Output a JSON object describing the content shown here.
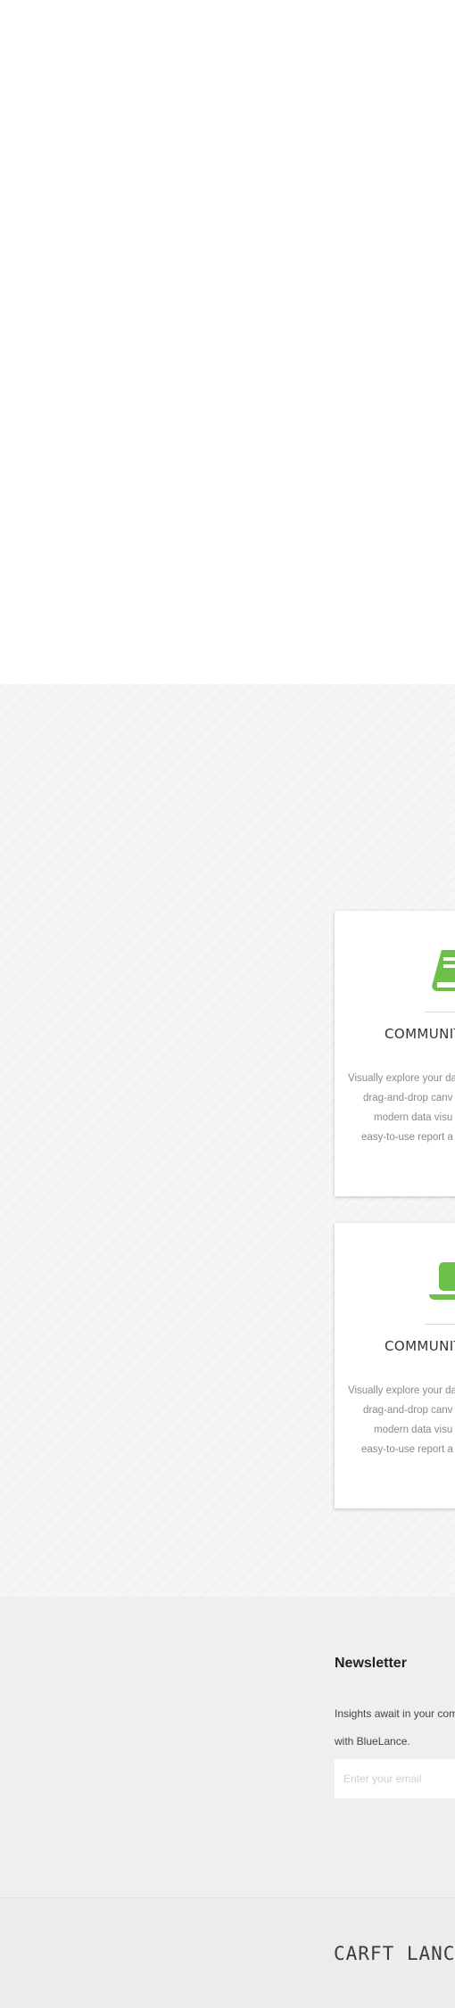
{
  "features": {
    "cards": [
      {
        "icon": "book-icon",
        "title": "COMMUNIT",
        "lines": [
          "Visually explore your da",
          "drag-and-drop canv",
          "modern data visu",
          "easy-to-use report a"
        ]
      },
      {
        "icon": "laptop-icon",
        "title": "COMMUNIT",
        "lines": [
          "Visually explore your da",
          "drag-and-drop canv",
          "modern data visu",
          "easy-to-use report a"
        ]
      }
    ],
    "accent_color": "#6cc04a"
  },
  "newsletter": {
    "title": "Newsletter",
    "text_line1": "Insights await in your com",
    "text_line2": "with BlueLance.",
    "email_placeholder": "Enter your email"
  },
  "footer": {
    "logo": "CARFT LANCE"
  }
}
